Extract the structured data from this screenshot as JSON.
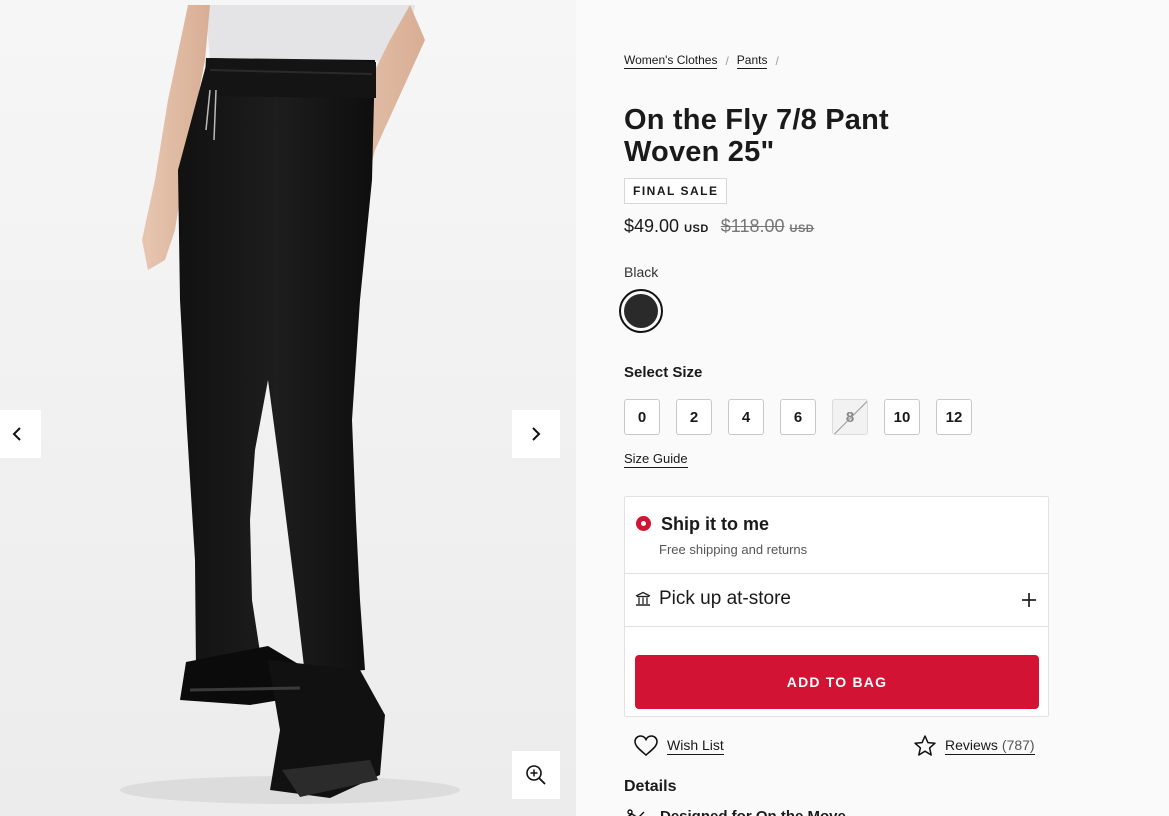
{
  "gallery": {
    "prev_icon": "chevron-left-icon",
    "next_icon": "chevron-right-icon",
    "zoom_icon": "zoom-in-icon"
  },
  "breadcrumb": [
    {
      "label": "Women's Clothes"
    },
    {
      "label": "Pants"
    }
  ],
  "breadcrumb_separator": "/",
  "product": {
    "title": "On the Fly 7/8 Pant Woven 25\"",
    "badge": "FINAL SALE",
    "price": "$49.00",
    "currency": "USD",
    "original_price": "$118.00",
    "original_currency": "USD",
    "color_name": "Black",
    "swatch_color": "#2a2a2a"
  },
  "size": {
    "label": "Select Size",
    "options": [
      {
        "label": "0",
        "available": true
      },
      {
        "label": "2",
        "available": true
      },
      {
        "label": "4",
        "available": true
      },
      {
        "label": "6",
        "available": true
      },
      {
        "label": "8",
        "available": false
      },
      {
        "label": "10",
        "available": true
      },
      {
        "label": "12",
        "available": true
      }
    ],
    "guide_label": "Size Guide"
  },
  "fulfillment": {
    "ship_title": "Ship it to me",
    "ship_subtitle": "Free shipping and returns",
    "pickup_title": "Pick up at-store",
    "add_to_bag": "ADD TO BAG"
  },
  "actions": {
    "wishlist_label": "Wish List",
    "reviews_label": "Reviews",
    "reviews_count": "(787)"
  },
  "details": {
    "heading": "Details",
    "first_feature": "Designed for On the Move"
  },
  "colors": {
    "accent": "#d31334",
    "text": "#1a1a1a"
  }
}
